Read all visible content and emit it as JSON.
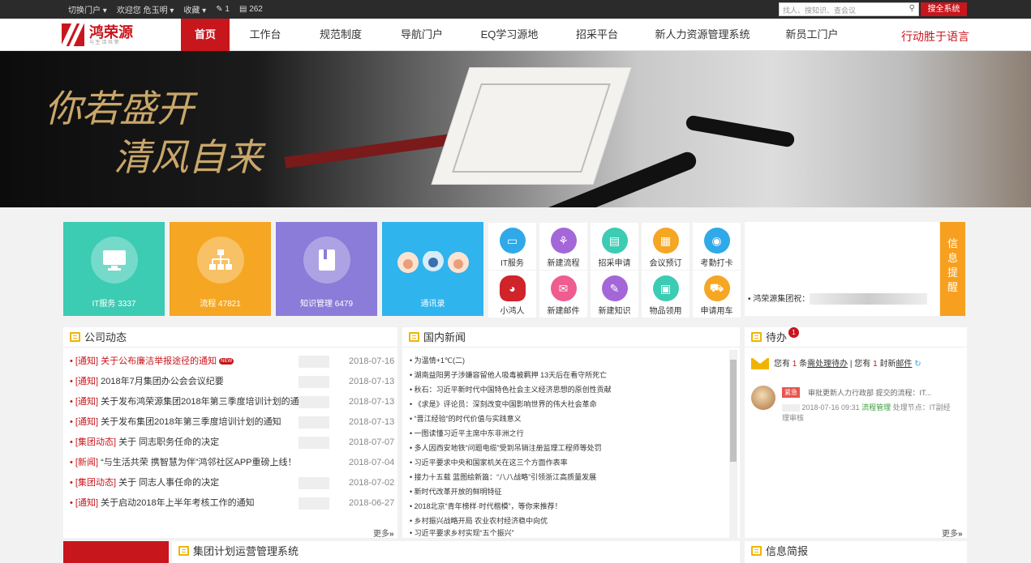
{
  "topbar": {
    "switch_portal": "切换门户",
    "welcome": "欢迎您",
    "user": "危玉明",
    "favorites": "收藏",
    "edit_count": "1",
    "doc_count": "262",
    "search_placeholder": "找人、搜知识、查会议",
    "search_button": "搜全系统"
  },
  "logo": {
    "name": "鸿荣源",
    "sub": "与 生 活 共 荣"
  },
  "nav": {
    "items": [
      "首页",
      "工作台",
      "规范制度",
      "导航门户",
      "EQ学习源地",
      "招采平台",
      "新人力资源管理系统",
      "新员工门户"
    ],
    "slogan": "行动胜于语言"
  },
  "banner": {
    "line1": "你若盛开",
    "line2": "清风自来"
  },
  "tiles": [
    {
      "label": "IT服务  3337",
      "color": "#3ccbb3"
    },
    {
      "label": "流程  47821",
      "color": "#f5a623"
    },
    {
      "label": "知识管理  6479",
      "color": "#8a7cd8"
    },
    {
      "label": "通讯录",
      "color": "#2fb4ee"
    }
  ],
  "quick": [
    {
      "label": "IT服务",
      "icon": "monitor-icon",
      "color": "#2fa9e8"
    },
    {
      "label": "新建流程",
      "icon": "org-icon",
      "color": "#a467d8"
    },
    {
      "label": "招采申请",
      "icon": "doc-icon",
      "color": "#3ccbb3"
    },
    {
      "label": "会议预订",
      "icon": "board-icon",
      "color": "#f5a623"
    },
    {
      "label": "考勤打卡",
      "icon": "location-icon",
      "color": "#2fa9e8"
    },
    {
      "label": "小鸿人",
      "icon": "mascot-icon",
      "color": "#d0232a"
    },
    {
      "label": "新建邮件",
      "icon": "mail-icon",
      "color": "#ef5c8f"
    },
    {
      "label": "新建知识",
      "icon": "note-icon",
      "color": "#a467d8"
    },
    {
      "label": "物品领用",
      "icon": "chat-icon",
      "color": "#3ccbb3"
    },
    {
      "label": "申请用车",
      "icon": "car-icon",
      "color": "#f5a623"
    }
  ],
  "info": {
    "line": "鸿荣源集团祝：",
    "tab": "信息提醒"
  },
  "company": {
    "title": "公司动态",
    "rows": [
      {
        "tag": "[通知]",
        "text": "关于公布廉洁举报途径的通知",
        "date": "2018-07-16",
        "is_new": true,
        "new_label": "NEW"
      },
      {
        "tag": "[通知]",
        "text": "2018年7月集团办公会会议纪要",
        "date": "2018-07-13"
      },
      {
        "tag": "[通知]",
        "text": "关于发布鸿荣源集团2018年第三季度培训计划的通知",
        "date": "2018-07-13"
      },
      {
        "tag": "[通知]",
        "text": "关于发布集团2018年第三季度培训计划的通知",
        "date": "2018-07-13"
      },
      {
        "tag": "[集团动态]",
        "text": "关于        同志职务任命的决定",
        "date": "2018-07-07"
      },
      {
        "tag": "[新闻]",
        "text": "“与生活共荣 携智慧为伴”鸿邻社区APP重磅上线！",
        "date": "2018-07-04"
      },
      {
        "tag": "[集团动态]",
        "text": "关于        同志人事任命的决定",
        "date": "2018-07-02"
      },
      {
        "tag": "[通知]",
        "text": "关于启动2018年上半年考核工作的通知",
        "date": "2018-06-27"
      }
    ],
    "more": "更多"
  },
  "domestic": {
    "title": "国内新闻",
    "rows": [
      "为温情+1℃(二)",
      "湖南益阳男子涉嫌容留他人吸毒被羁押 13天后在看守所死亡",
      "秋石：习近平新时代中国特色社会主义经济思想的原创性贡献",
      "《求是》评论员：深刻改变中国影响世界的伟大社会革命",
      "“晋江经验”的时代价值与实践意义",
      "一图读懂习近平主席中东非洲之行",
      "多人因西安地铁“问题电缆”受到吊销注册监理工程师等处罚",
      "习近平要求中央和国家机关在这三个方面作表率",
      "接力十五载 蓝图绘新篇：“八八战略”引领浙江高质量发展",
      "新时代改革开放的鲜明特征",
      "2018北京“青年榜样·时代楷模”，等你来推荐！",
      "乡村振兴战略开局 农业农村经济稳中向优",
      "习近平要求乡村实现“五个振兴”"
    ]
  },
  "todo": {
    "title": "待办",
    "badge": "1",
    "p1": "您有",
    "n1": "1",
    "p2": "条",
    "link1": "需处理待办",
    "p3": "| 您有",
    "n2": "1",
    "p4": "封新",
    "link2": "邮件",
    "urgent": "紧急",
    "item_text": "审批更新人力行政部      提交的流程：IT...",
    "item_time": "2018-07-16 09:31",
    "item_cat": "流程管理",
    "item_node": "处理节点：IT副经",
    "item_node2": "理审核",
    "more": "更多"
  },
  "bottom": {
    "plan_title": "集团计划运营管理系统",
    "brief_title": "信息简报"
  }
}
